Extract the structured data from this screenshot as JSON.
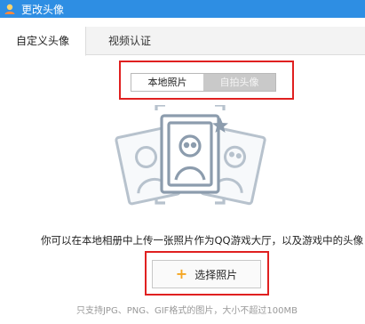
{
  "window": {
    "title": "更改头像"
  },
  "tabs": [
    {
      "label": "自定义头像",
      "active": true
    },
    {
      "label": "视频认证",
      "active": false
    }
  ],
  "mode_switch": {
    "local_label": "本地照片",
    "selfie_label": "自拍头像",
    "selected": "本地照片"
  },
  "illustration": {
    "icon": "avatar-cards-icon"
  },
  "description": "你可以在本地相册中上传一张照片作为QQ游戏大厅，以及游戏中的头像",
  "pick_button": {
    "label": "选择照片",
    "icon": "plus-icon"
  },
  "hint": "只支持JPG、PNG、GIF格式的图片，大小不超过100MB",
  "colors": {
    "titlebar": "#2e8ee3",
    "highlight_border": "#e02020",
    "plus": "#f5a623",
    "illustration": "#9aa9b8"
  }
}
